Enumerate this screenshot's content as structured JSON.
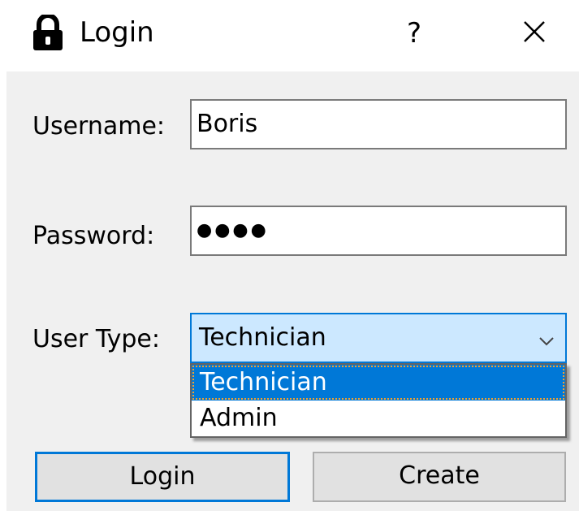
{
  "window": {
    "title": "Login",
    "help_label": "?"
  },
  "form": {
    "username_label": "Username:",
    "username_value": "Boris",
    "password_label": "Password:",
    "password_value": "●●●●",
    "user_type_label": "User Type:",
    "user_type_value": "Technician",
    "user_type_options": [
      "Technician",
      "Admin"
    ]
  },
  "buttons": {
    "login_label": "Login",
    "create_label": "Create"
  },
  "icons": {
    "title_icon": "lock-icon",
    "close_icon": "close-icon",
    "dropdown_icon": "chevron-down-icon"
  },
  "colors": {
    "accent": "#0078d7",
    "selection_bg": "#0078d7",
    "combo_focus_bg": "#cce8ff",
    "client_bg": "#f0f0f0",
    "button_bg": "#e1e1e1"
  }
}
